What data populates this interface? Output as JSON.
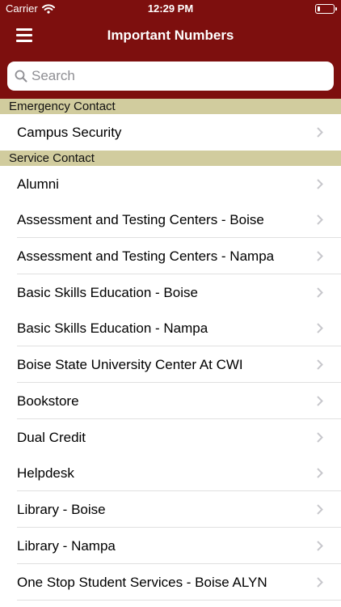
{
  "status_bar": {
    "carrier": "Carrier",
    "time": "12:29 PM"
  },
  "nav": {
    "title": "Important Numbers"
  },
  "search": {
    "placeholder": "Search"
  },
  "sections": [
    {
      "header": "Emergency Contact",
      "items": [
        "Campus Security"
      ]
    },
    {
      "header": "Service Contact",
      "items": [
        "Alumni",
        "Assessment and Testing Centers - Boise",
        "Assessment and Testing Centers - Nampa",
        "Basic Skills Education - Boise",
        "Basic Skills Education - Nampa",
        "Boise State University Center At CWI",
        "Bookstore",
        "Dual Credit",
        "Helpdesk",
        "Library - Boise",
        "Library - Nampa",
        "One Stop Student Services - Boise ALYN"
      ]
    }
  ],
  "colors": {
    "brand": "#7d0f0e",
    "section_header": "#d1cc9e",
    "chevron": "#c7c7cc"
  }
}
